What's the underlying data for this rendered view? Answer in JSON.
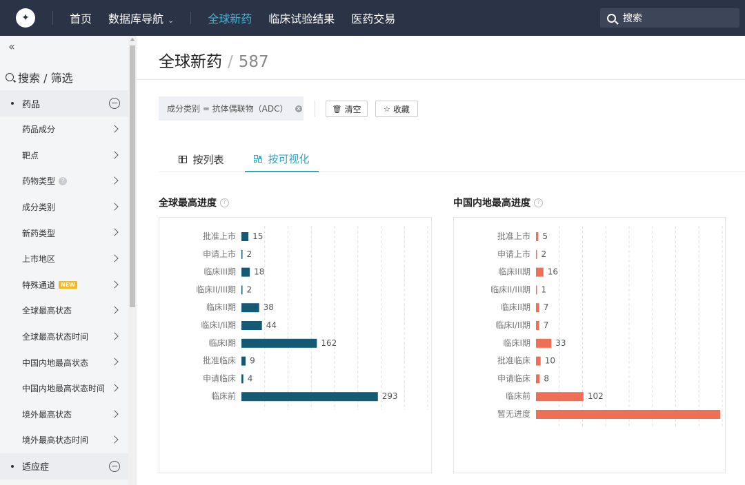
{
  "nav": {
    "logo_icon": "tianxing-logo",
    "items": [
      "首页",
      "数据库导航",
      "全球新药",
      "临床试验结果",
      "医药交易"
    ],
    "active": "全球新药",
    "search_placeholder": "搜索"
  },
  "sidebar": {
    "collapse": "«",
    "filter_title": "搜索 / 筛选",
    "groups": [
      {
        "label": "药品",
        "items": [
          {
            "label": "药品成分"
          },
          {
            "label": "靶点"
          },
          {
            "label": "药物类型",
            "help": "?"
          },
          {
            "label": "成分类别"
          },
          {
            "label": "新药类型"
          },
          {
            "label": "上市地区"
          },
          {
            "label": "特殊通道",
            "badge": "NEW"
          },
          {
            "label": "全球最高状态"
          },
          {
            "label": "全球最高状态时间"
          },
          {
            "label": "中国内地最高状态"
          },
          {
            "label": "中国内地最高状态时间"
          },
          {
            "label": "境外最高状态"
          },
          {
            "label": "境外最高状态时间"
          }
        ]
      },
      {
        "label": "适应症",
        "items": []
      }
    ]
  },
  "main": {
    "title": "全球新药",
    "count": "587",
    "filter_chip": "成分类别 = 抗体偶联物（ADC）",
    "clear_label": "清空",
    "favorite_label": "收藏",
    "tabs": [
      "按列表",
      "按可视化"
    ],
    "active_tab": "按可视化"
  },
  "chart_data": [
    {
      "type": "bar",
      "orientation": "horizontal",
      "title": "全球最高进度",
      "categories": [
        "批准上市",
        "申请上市",
        "临床III期",
        "临床II/III期",
        "临床II期",
        "临床I/II期",
        "临床I期",
        "批准临床",
        "申请临床",
        "临床前"
      ],
      "values": [
        15,
        2,
        18,
        2,
        38,
        44,
        162,
        9,
        4,
        293
      ],
      "color": "#155a75",
      "xlim": [
        0,
        400
      ],
      "grid": "vertical-dashed"
    },
    {
      "type": "bar",
      "orientation": "horizontal",
      "title": "中国内地最高进度",
      "categories": [
        "批准上市",
        "申请上市",
        "临床III期",
        "临床II/III期",
        "临床II期",
        "临床I/II期",
        "临床I期",
        "批准临床",
        "申请临床",
        "临床前",
        "暂无进度"
      ],
      "values": [
        5,
        2,
        16,
        1,
        7,
        7,
        33,
        10,
        8,
        102,
        396
      ],
      "color": "#ef6f56",
      "xlim": [
        0,
        400
      ],
      "grid": "vertical-dashed"
    }
  ]
}
